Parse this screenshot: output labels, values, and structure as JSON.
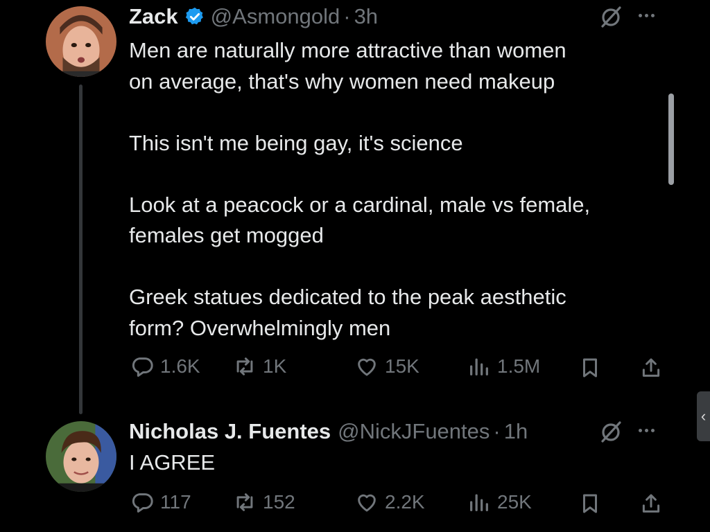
{
  "main_tweet": {
    "author_name": "Zack",
    "handle": "@Asmongold",
    "separator": "·",
    "time": "3h",
    "lines": [
      "Men are naturally more attractive than women",
      "on average, that's why women need makeup",
      "",
      "This isn't me being gay, it's science",
      "",
      "Look at a peacock or a cardinal, male vs female,",
      "females get mogged",
      "",
      "Greek statues dedicated to the peak aesthetic",
      "form? Overwhelmingly men"
    ],
    "replies": "1.6K",
    "reposts": "1K",
    "likes": "15K",
    "views": "1.5M"
  },
  "reply_tweet": {
    "author_name": "Nicholas J. Fuentes",
    "handle": "@NickJFuentes",
    "separator": "·",
    "time": "1h",
    "text": "I AGREE",
    "replies": "117",
    "reposts": "152",
    "likes": "2.2K",
    "views": "25K"
  },
  "icons": {
    "verified": "verified-badge-icon",
    "grok": "grok-icon",
    "more": "more-icon",
    "reply": "reply-icon",
    "repost": "repost-icon",
    "like": "heart-icon",
    "views": "views-icon",
    "bookmark": "bookmark-icon",
    "share": "share-icon",
    "collapse": "chevron-left-icon"
  },
  "side_tab_glyph": "‹",
  "colors": {
    "background": "#000000",
    "text": "#e7e9ea",
    "secondary_text": "#71767b",
    "verified_blue": "#1d9bf0",
    "thread_line": "#333639"
  }
}
